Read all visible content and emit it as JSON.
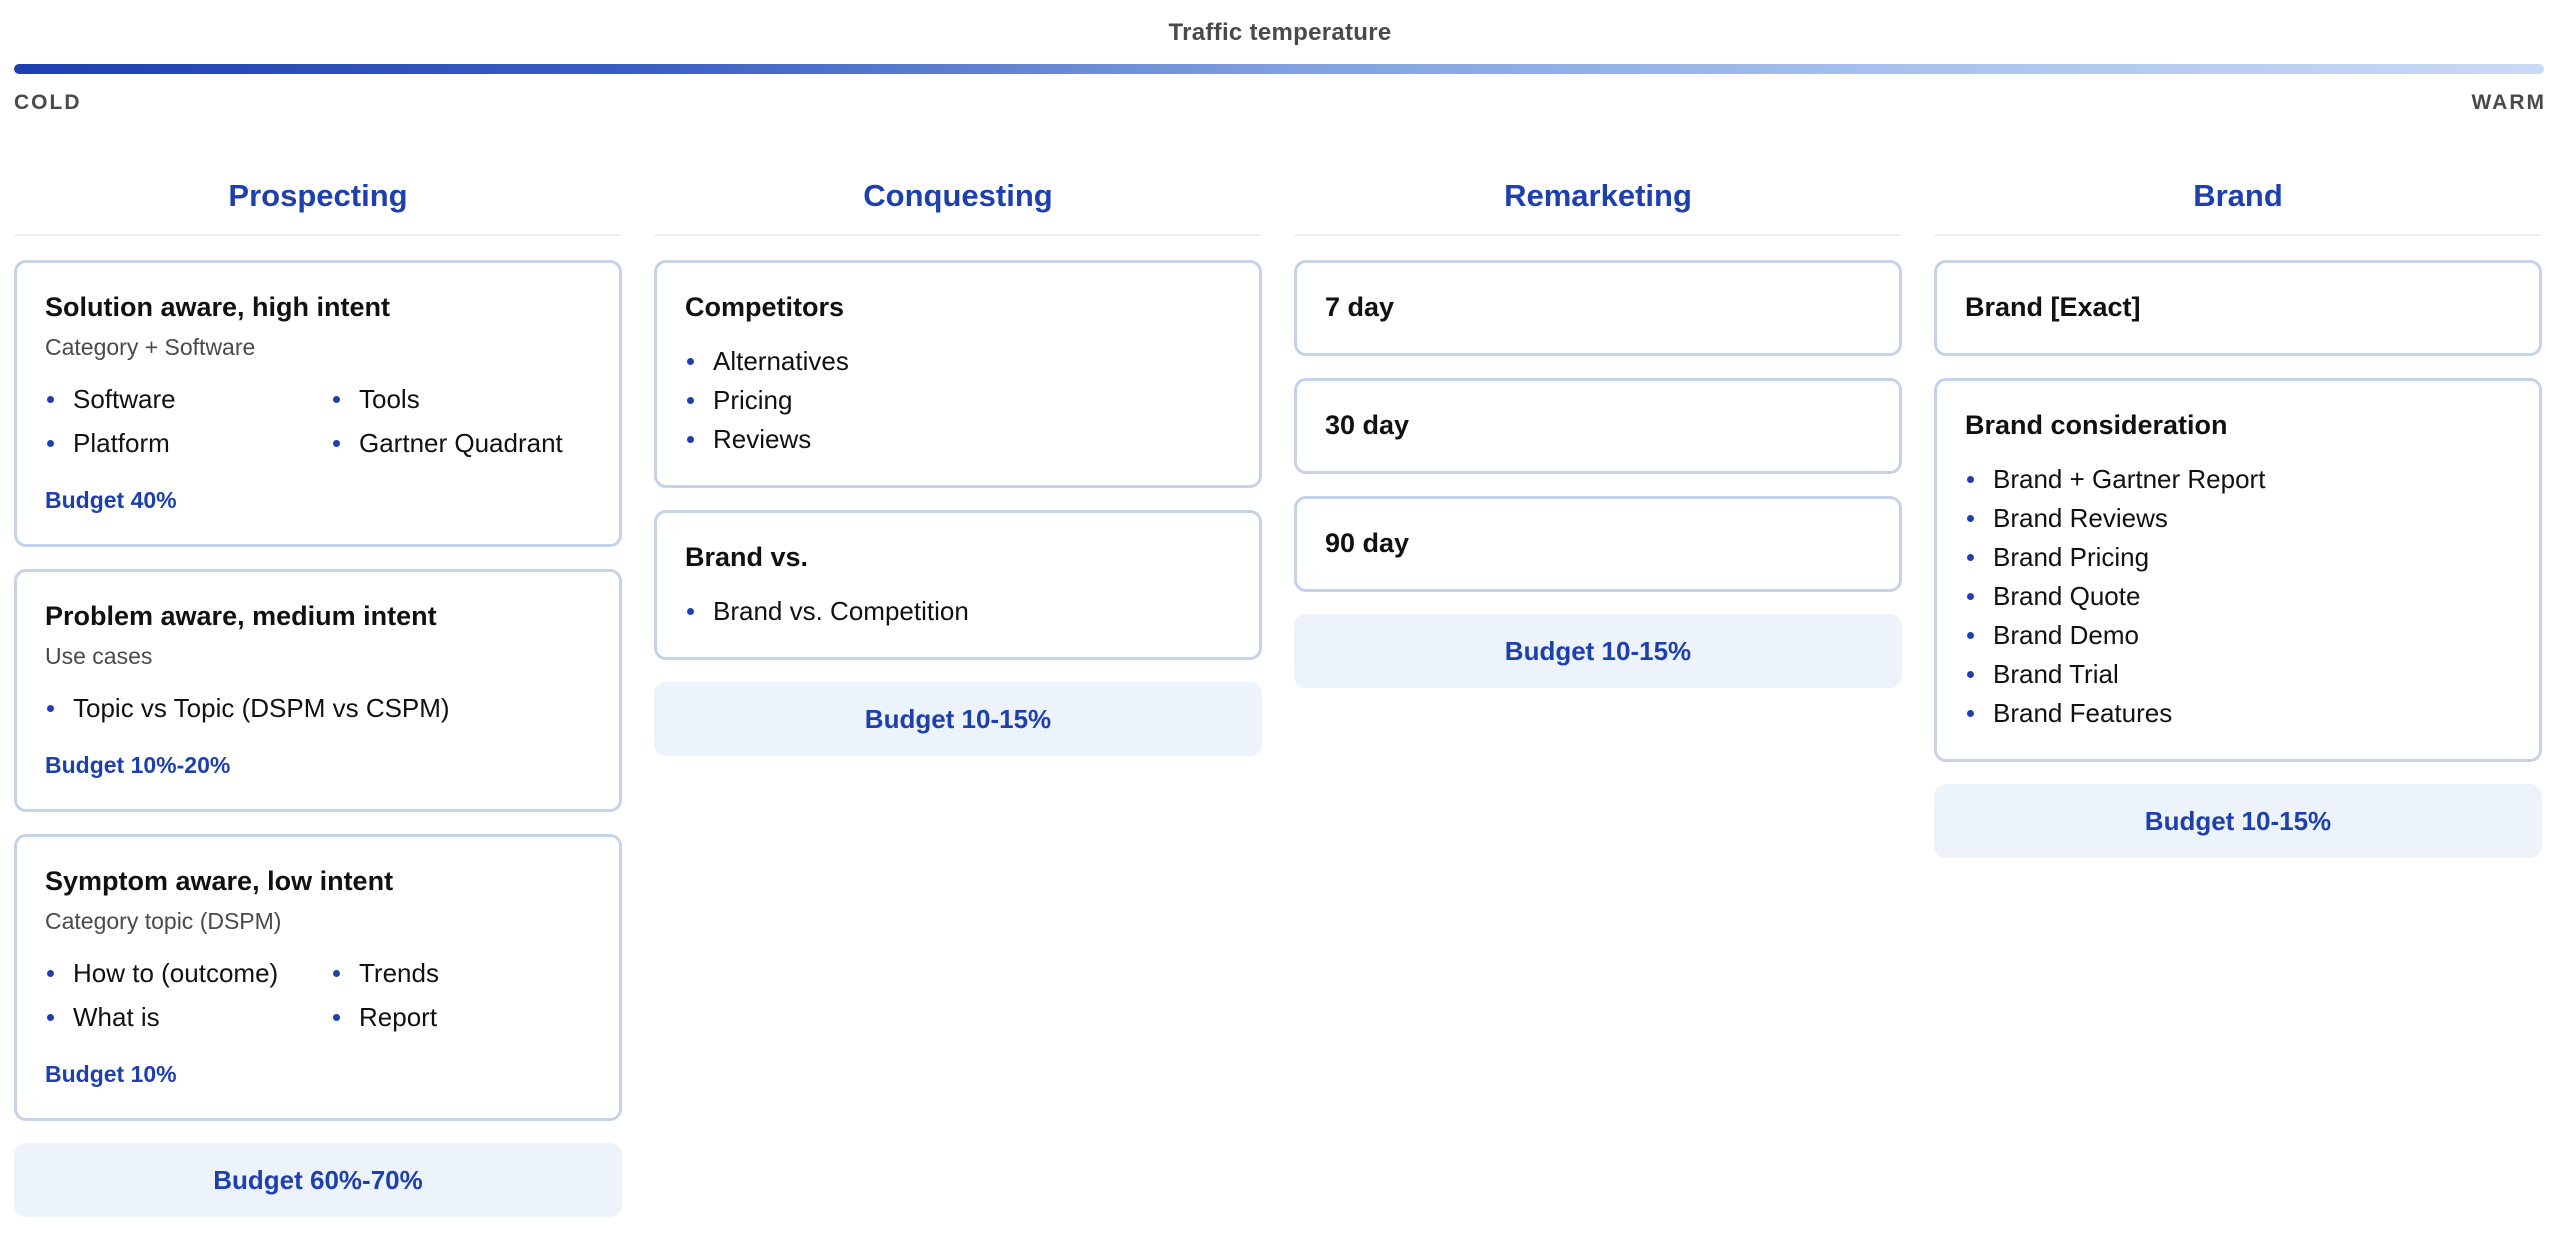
{
  "header": {
    "title": "Traffic temperature",
    "cold_label": "COLD",
    "warm_label": "WARM",
    "gradient_start": "#1e40af",
    "gradient_end": "#c9daf6"
  },
  "colors": {
    "accent": "#1e40af",
    "card_border": "#c5d3ea",
    "budget_bg": "#edf3fb"
  },
  "columns": [
    {
      "title": "Prospecting",
      "cards": [
        {
          "title": "Solution aware, high intent",
          "subtitle": "Category + Software",
          "items": [
            "Software",
            "Tools",
            "Platform",
            "Gartner Quadrant"
          ],
          "budget": "Budget 40%"
        },
        {
          "title": "Problem aware, medium intent",
          "subtitle": "Use cases",
          "items": [
            "Topic vs Topic (DSPM vs CSPM)"
          ],
          "budget": "Budget 10%-20%"
        },
        {
          "title": "Symptom aware, low intent",
          "subtitle": "Category topic (DSPM)",
          "items": [
            "How to (outcome)",
            "Trends",
            "What is",
            "Report"
          ],
          "budget": "Budget 10%"
        }
      ],
      "budget": "Budget 60%-70%"
    },
    {
      "title": "Conquesting",
      "cards": [
        {
          "title": "Competitors",
          "items": [
            "Alternatives",
            "Pricing",
            "Reviews"
          ]
        },
        {
          "title": "Brand vs.",
          "items": [
            "Brand vs. Competition"
          ]
        }
      ],
      "budget": "Budget 10-15%"
    },
    {
      "title": "Remarketing",
      "cards": [
        {
          "title": "7 day"
        },
        {
          "title": "30 day"
        },
        {
          "title": "90 day"
        }
      ],
      "budget": "Budget 10-15%"
    },
    {
      "title": "Brand",
      "cards": [
        {
          "title": "Brand [Exact]"
        },
        {
          "title": "Brand consideration",
          "items": [
            "Brand + Gartner Report",
            "Brand Reviews",
            "Brand Pricing",
            "Brand Quote",
            "Brand Demo",
            "Brand Trial",
            "Brand Features"
          ]
        }
      ],
      "budget": "Budget 10-15%"
    }
  ]
}
